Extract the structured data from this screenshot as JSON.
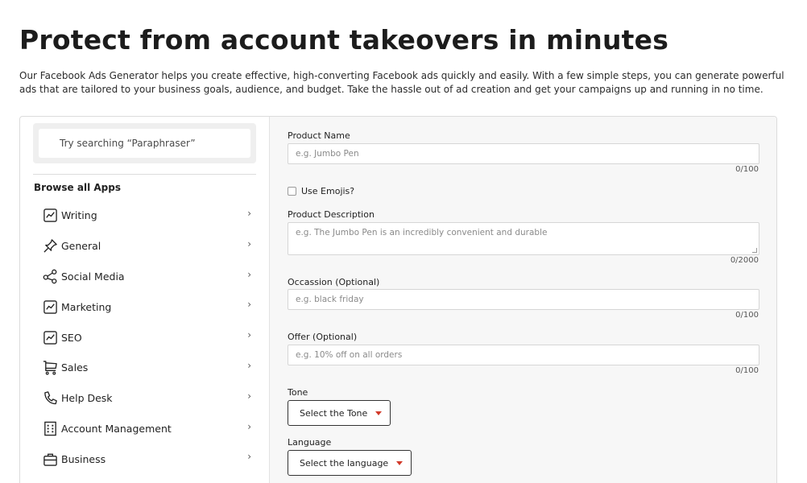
{
  "page": {
    "title": "Protect from account takeovers in minutes",
    "description": "Our Facebook Ads Generator helps you create effective, high-converting Facebook ads quickly and easily. With a few simple steps, you can generate powerful ads that are tailored to your business goals, audience, and budget. Take the hassle out of ad creation and get your campaigns up and running in no time."
  },
  "sidebar": {
    "search_placeholder": "Try searching “Paraphraser”",
    "browse_title": "Browse all Apps",
    "chevron": "›",
    "items": [
      {
        "label": "Writing",
        "icon": "chart-line-icon"
      },
      {
        "label": "General",
        "icon": "pin-icon"
      },
      {
        "label": "Social Media",
        "icon": "share-icon"
      },
      {
        "label": "Marketing",
        "icon": "chart-line-icon"
      },
      {
        "label": "SEO",
        "icon": "chart-line-icon"
      },
      {
        "label": "Sales",
        "icon": "cart-icon"
      },
      {
        "label": "Help Desk",
        "icon": "phone-icon"
      },
      {
        "label": "Account Management",
        "icon": "building-icon"
      },
      {
        "label": "Business",
        "icon": "briefcase-icon"
      }
    ]
  },
  "form": {
    "product_name": {
      "label": "Product Name",
      "placeholder": "e.g. Jumbo Pen",
      "counter": "0/100"
    },
    "use_emojis": {
      "label": "Use Emojis?"
    },
    "product_description": {
      "label": "Product Description",
      "placeholder": "e.g. The Jumbo Pen is an incredibly convenient and durable",
      "counter": "0/2000"
    },
    "occasion": {
      "label": "Occassion (Optional)",
      "placeholder": "e.g. black friday",
      "counter": "0/100"
    },
    "offer": {
      "label": "Offer (Optional)",
      "placeholder": "e.g. 10% off on all orders",
      "counter": "0/100"
    },
    "tone": {
      "label": "Tone",
      "selected": "Select the Tone"
    },
    "language": {
      "label": "Language",
      "selected": "Select the language"
    }
  },
  "colors": {
    "caret": "#d23a2a",
    "form_bg": "#f7f7f7"
  }
}
